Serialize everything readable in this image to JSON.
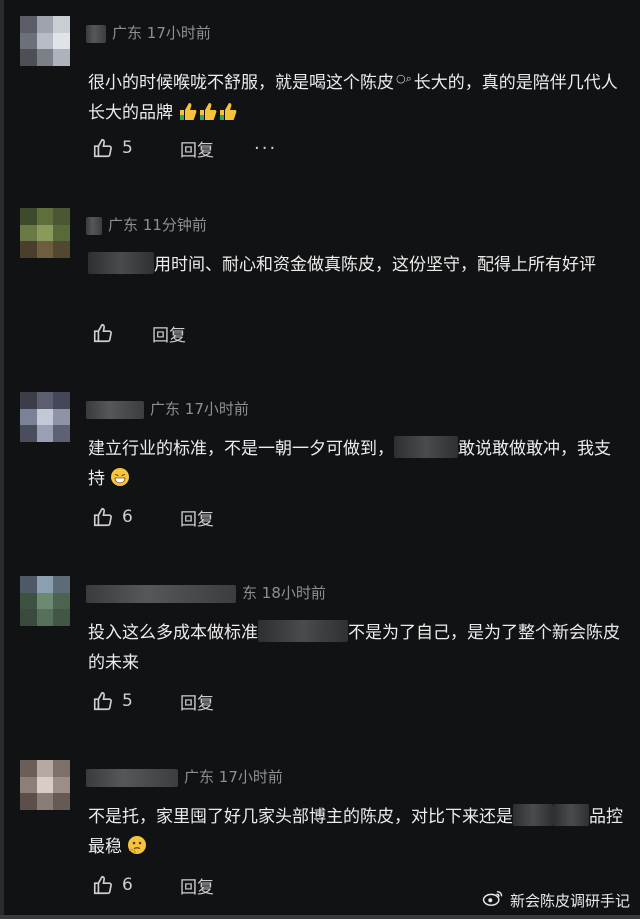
{
  "comments": [
    {
      "location": "广东",
      "time": "17小时前",
      "text_a": "很小的时候喉咙不舒服，就是喝这个陈皮",
      "text_b": "长大的，真的是陪伴几代人长大的品牌",
      "likes": "5",
      "reply": "回复",
      "more": "···"
    },
    {
      "location": "广东",
      "time": "11分钟前",
      "text_a": "用时间、耐心和资金做真陈皮，这份坚守，配得上所有好评",
      "likes": "",
      "reply": "回复"
    },
    {
      "location": "广东",
      "time": "17小时前",
      "text_a": "建立行业的标准，不是一朝一夕可做到，",
      "text_b": "敢说敢做敢冲，我支持",
      "likes": "6",
      "reply": "回复"
    },
    {
      "location": "东",
      "time": "18小时前",
      "text_a": "投入这么多成本做标准",
      "text_b": "不是为了自己，是为了整个新会陈皮的未来",
      "likes": "5",
      "reply": "回复"
    },
    {
      "location": "广东",
      "time": "17小时前",
      "text_a": "不是托，家里囤了好几家头部博主的陈皮，对比下来还是",
      "text_b": "品控最稳",
      "likes": "6",
      "reply": "回复"
    }
  ],
  "watermark": "新会陈皮调研手记",
  "colors": {
    "background": "#111214",
    "meta": "#8d8f94",
    "text": "#ececec"
  }
}
